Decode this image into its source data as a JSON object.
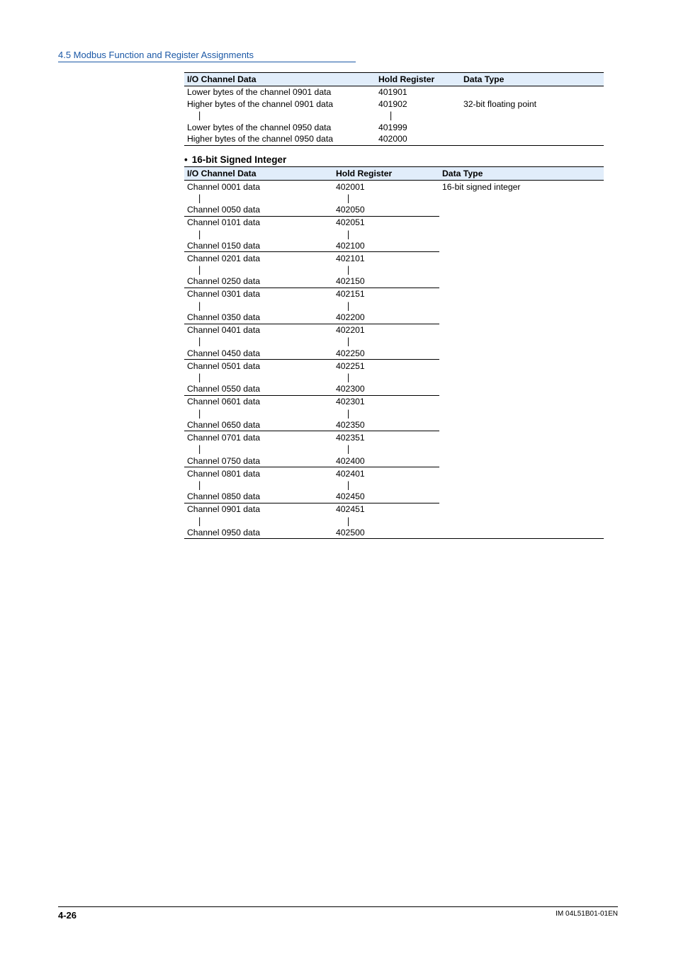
{
  "section": {
    "title": "4.5  Modbus Function and Register Assignments"
  },
  "table1": {
    "headers": {
      "c1": "I/O Channel Data",
      "c2": "Hold Register",
      "c3": "Data Type"
    },
    "rows": [
      {
        "c1": "Lower bytes of the channel 0901 data",
        "c2": "401901",
        "c3": ""
      },
      {
        "c1": "Higher bytes of the channel 0901 data",
        "c2": "401902",
        "c3": "32-bit floating point"
      },
      {
        "c1": "|",
        "c2": "|",
        "c3": "",
        "vbar": true
      },
      {
        "c1": "Lower bytes of the channel 0950 data",
        "c2": "401999",
        "c3": ""
      },
      {
        "c1": "Higher bytes of the channel 0950 data",
        "c2": "402000",
        "c3": ""
      }
    ]
  },
  "subheading": {
    "bullet": "•",
    "text": "16-bit Signed Integer"
  },
  "table2": {
    "headers": {
      "c1": "I/O Channel Data",
      "c2": "Hold Register",
      "c3": "Data Type"
    },
    "dtype": "16-bit signed integer",
    "groups": [
      {
        "top": {
          "c1": "Channel 0001 data",
          "c2": "402001"
        },
        "bot": {
          "c1": "Channel 0050 data",
          "c2": "402050"
        }
      },
      {
        "top": {
          "c1": "Channel 0101 data",
          "c2": "402051"
        },
        "bot": {
          "c1": "Channel 0150 data",
          "c2": "402100"
        }
      },
      {
        "top": {
          "c1": "Channel 0201 data",
          "c2": "402101"
        },
        "bot": {
          "c1": "Channel 0250 data",
          "c2": "402150"
        }
      },
      {
        "top": {
          "c1": "Channel 0301 data",
          "c2": "402151"
        },
        "bot": {
          "c1": "Channel 0350 data",
          "c2": "402200"
        }
      },
      {
        "top": {
          "c1": "Channel 0401 data",
          "c2": "402201"
        },
        "bot": {
          "c1": "Channel 0450 data",
          "c2": "402250"
        }
      },
      {
        "top": {
          "c1": "Channel 0501 data",
          "c2": "402251"
        },
        "bot": {
          "c1": "Channel 0550 data",
          "c2": "402300"
        }
      },
      {
        "top": {
          "c1": "Channel 0601 data",
          "c2": "402301"
        },
        "bot": {
          "c1": "Channel 0650 data",
          "c2": "402350"
        }
      },
      {
        "top": {
          "c1": "Channel 0701 data",
          "c2": "402351"
        },
        "bot": {
          "c1": "Channel 0750 data",
          "c2": "402400"
        }
      },
      {
        "top": {
          "c1": "Channel 0801 data",
          "c2": "402401"
        },
        "bot": {
          "c1": "Channel 0850 data",
          "c2": "402450"
        }
      },
      {
        "top": {
          "c1": "Channel 0901 data",
          "c2": "402451"
        },
        "bot": {
          "c1": "Channel 0950 data",
          "c2": "402500"
        }
      }
    ]
  },
  "footer": {
    "left": "4-26",
    "right": "IM 04L51B01-01EN"
  }
}
